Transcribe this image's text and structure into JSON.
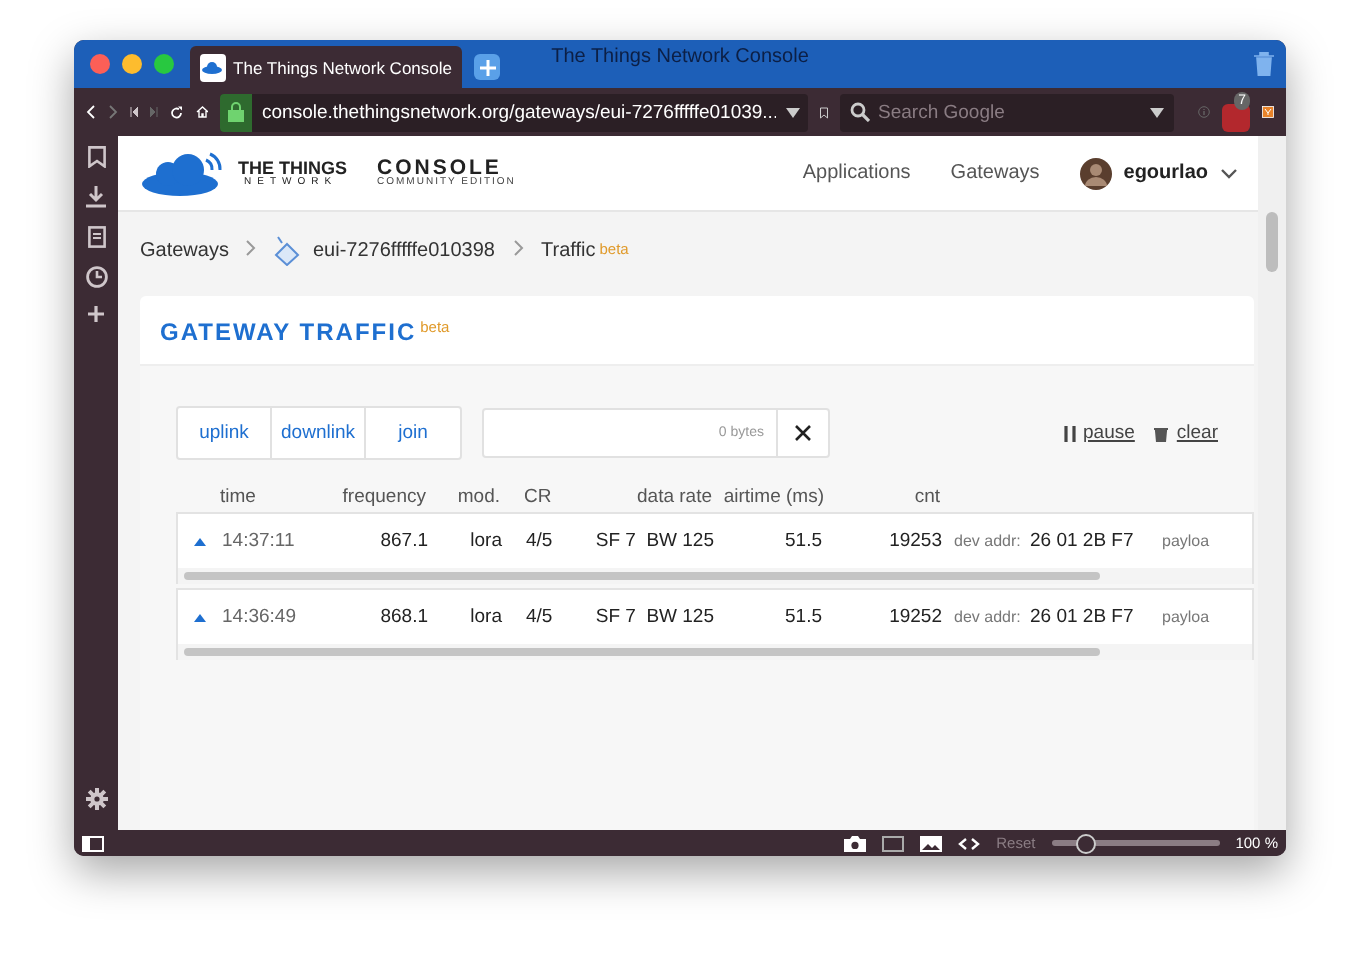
{
  "window": {
    "title": "The Things Network Console"
  },
  "browser_tab": {
    "title": "The Things Network Console",
    "selected": true
  },
  "toolbar": {
    "url": "console.thethingsnetwork.org/gateways/eui-7276fffffe01039...",
    "search": {
      "placeholder": "Search Google"
    },
    "extension_badge": "7"
  },
  "app_header": {
    "brand_top": "THE THINGS",
    "brand_bottom": "NETWORK",
    "product": "CONSOLE",
    "edition": "COMMUNITY EDITION",
    "nav": [
      {
        "label": "Applications"
      },
      {
        "label": "Gateways"
      }
    ],
    "user": "egourlao"
  },
  "breadcrumbs": [
    {
      "label": "Gateways",
      "kind": "link"
    },
    {
      "label": "eui-7276fffffe010398",
      "kind": "gateway"
    },
    {
      "label": "Traffic",
      "kind": "current",
      "badge": "beta"
    }
  ],
  "card": {
    "title": "GATEWAY TRAFFIC",
    "badge": "beta",
    "filters": [
      {
        "label": "uplink"
      },
      {
        "label": "downlink"
      },
      {
        "label": "join"
      }
    ],
    "payload_filter": {
      "size": "0 bytes"
    },
    "actions": [
      {
        "label": "pause",
        "kind": "pause"
      },
      {
        "label": "clear",
        "kind": "clear"
      }
    ],
    "columns": [
      "time",
      "frequency",
      "mod.",
      "CR",
      "data rate",
      "airtime (ms)",
      "cnt"
    ],
    "rows": [
      {
        "kind": "uplink",
        "time": "14:37:11",
        "frequency": "867.1",
        "mod": "lora",
        "cr": "4/5",
        "sf": "SF 7",
        "bw": "BW 125",
        "airtime": "51.5",
        "cnt": "19253",
        "dev_addr_label": "dev addr:",
        "dev_addr": "26 01 2B F7",
        "payload_label": "payloa"
      },
      {
        "kind": "uplink",
        "time": "14:36:49",
        "frequency": "868.1",
        "mod": "lora",
        "cr": "4/5",
        "sf": "SF 7",
        "bw": "BW 125",
        "airtime": "51.5",
        "cnt": "19252",
        "dev_addr_label": "dev addr:",
        "dev_addr": "26 01 2B F7",
        "payload_label": "payloa"
      }
    ]
  },
  "status_bar": {
    "reset": "Reset",
    "zoom": {
      "level": 0.2
    },
    "zoom_text": "100 %"
  }
}
